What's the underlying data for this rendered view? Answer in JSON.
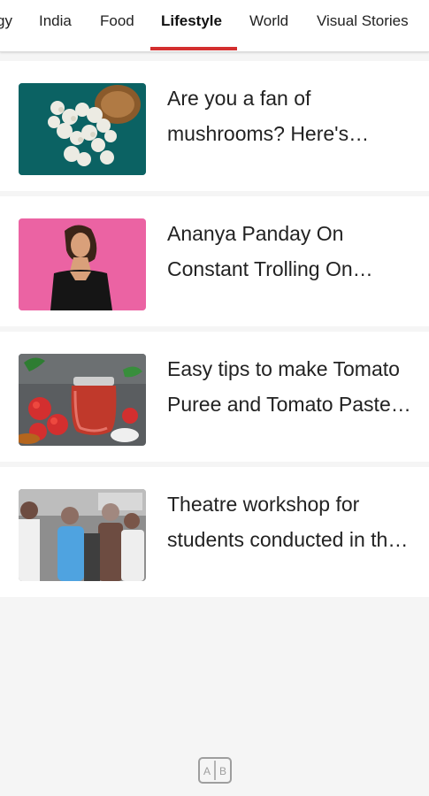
{
  "tabs": [
    {
      "label": "gy"
    },
    {
      "label": "India"
    },
    {
      "label": "Food"
    },
    {
      "label": "Lifestyle",
      "active": true
    },
    {
      "label": "World"
    },
    {
      "label": "Visual Stories"
    }
  ],
  "articles": [
    {
      "title": "Are you a fan of mushrooms? Here's everything you need to know",
      "thumbnail_icon": "mushrooms-image"
    },
    {
      "title": "Ananya Panday On Constant Trolling On Social Media",
      "thumbnail_icon": "person-portrait-image"
    },
    {
      "title": "Easy tips to make Tomato Puree and Tomato Paste at home",
      "thumbnail_icon": "tomato-puree-image"
    },
    {
      "title": "Theatre workshop for students conducted in the city",
      "thumbnail_icon": "workshop-group-image"
    }
  ],
  "footer": {
    "icon": "translate-icon"
  },
  "colors": {
    "accent": "#d32f2f",
    "text": "#222222",
    "background": "#f5f5f5"
  }
}
